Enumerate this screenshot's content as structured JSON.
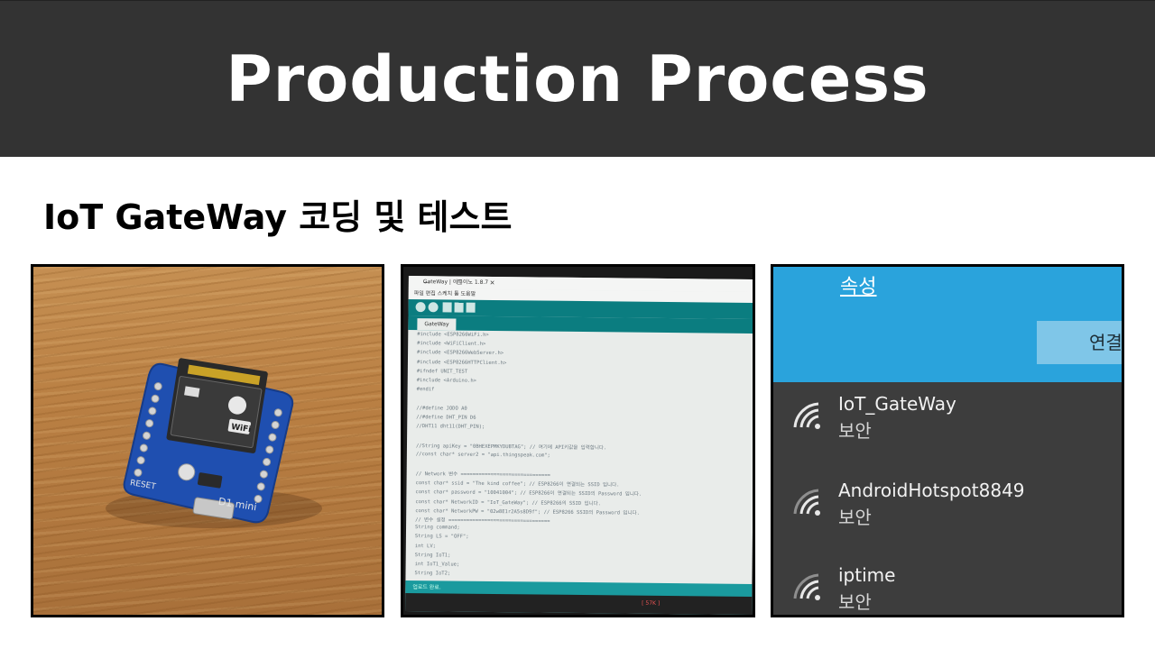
{
  "header": {
    "title": "Production Process"
  },
  "subtitle": "IoT GateWay 코딩 및 테스트",
  "photos": {
    "board": {
      "module_logo": "WiFi",
      "labels": [
        "RESET",
        "D1 mini"
      ]
    },
    "ide": {
      "window_title": "GateWay | 아두이노 1.8.7",
      "menu": "파일 편집 스케치 툴 도움말",
      "tab_label": "GateWay",
      "code_lines": [
        "#include <ESP8266WiFi.h>",
        "#include <WiFiClient.h>",
        "#include <ESP8266WebServer.h>",
        "#include <ESP8266HTTPClient.h>",
        "#ifndef UNIT_TEST",
        "#include <Arduino.h>",
        "#endif",
        "",
        "//#define JODO A0",
        "//#define DHT_PIN D6",
        "//DHT11 dht11(DHT_PIN);",
        "",
        "//String apiKey = \"0BHEXEPMKYDUBTAG\"; // 여기에 API키값을 입력합니다.",
        "//const char* server2 = \"api.thingspeak.com\";",
        "",
        "// Network 변수 ==============================",
        "const char* ssid = \"The kind coffee\"; // ESP8266이 연결되는 SSID 입니다.",
        "const char* password = \"10041004\"; // ESP8266이 연결되는 SSID의 Password 입니다.",
        "const char* NetworkID = \"IoT_GateWay\"; // ESP8266의 SSID 입니다.",
        "const char* NetworkPW = \"02w8E1r2A5s8D9f\"; // ESP8266 SSID의 Password 입니다.",
        "// 변수 설정 ==================================",
        "String command;",
        "String LS = \"OFF\";",
        "int LV;",
        "String IoT1;",
        "int IoT1_Value;",
        "String IoT2;"
      ],
      "status_text": "업로드 완료.",
      "counter": "[ 57K ]"
    },
    "wifi": {
      "properties_link": "속성",
      "connect_button": "연결",
      "networks": [
        {
          "name": "IoT_GateWay",
          "security": "보안"
        },
        {
          "name": "AndroidHotspot8849",
          "security": "보안"
        },
        {
          "name": "iptime",
          "security": "보안"
        }
      ]
    }
  },
  "colors": {
    "header_bg": "#333333",
    "wood": "#b97f43",
    "pcb_blue": "#1f4fb0",
    "arduino_teal": "#0b7d80",
    "wifi_blue": "#2aa3dc",
    "wifi_list_bg": "#3d3d3d"
  }
}
